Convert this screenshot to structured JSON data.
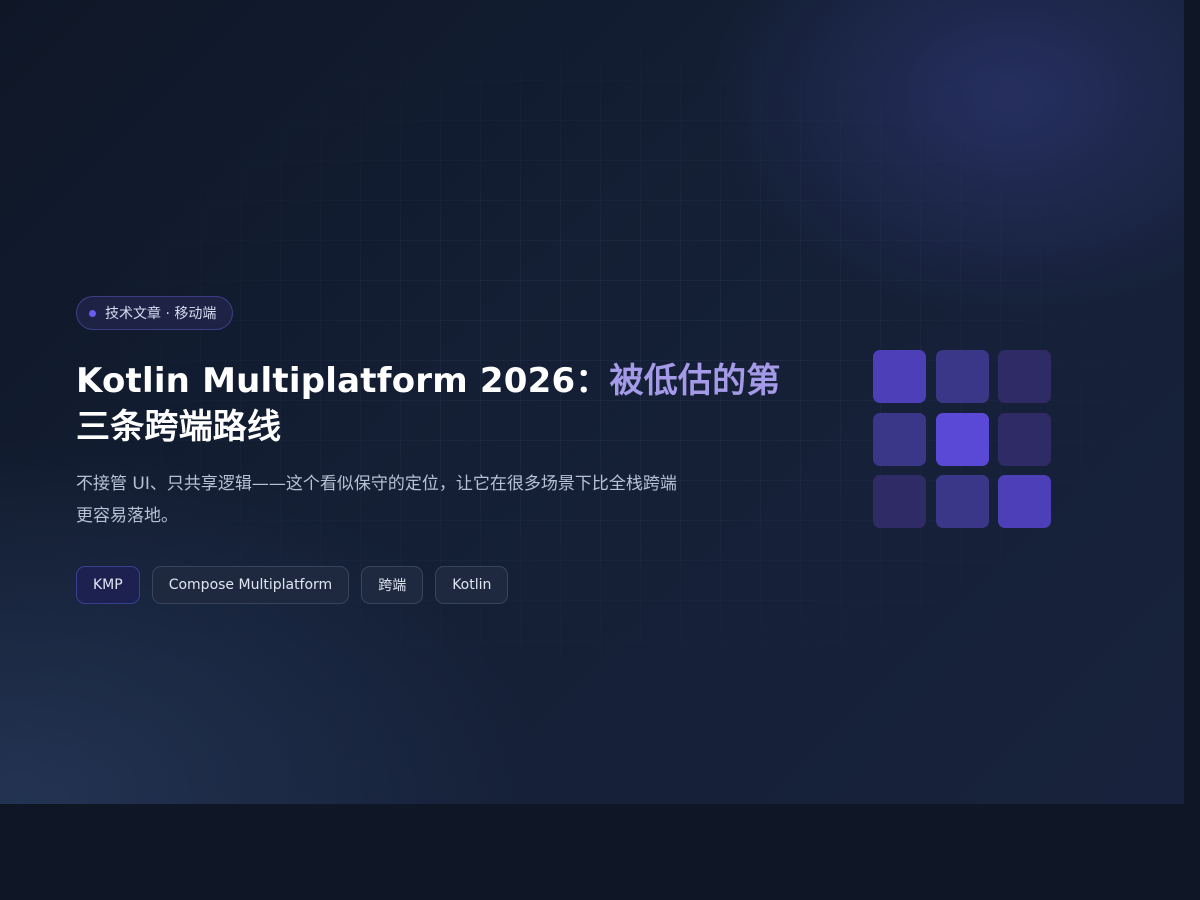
{
  "hero": {
    "category": "技术文章 · 移动端",
    "title_en": "Kotlin Multiplatform 2026：",
    "title_zh_accent": "被低估的第",
    "title_zh_rest": "三条跨端路线",
    "subtitle": "不接管 UI、只共享逻辑——这个看似保守的定位，让它在很多场景下比全栈跨端更容易落地。",
    "tags": [
      "KMP",
      "Compose Multiplatform",
      "跨端",
      "Kotlin"
    ]
  },
  "decoration": {
    "tile_colors": [
      "#4c3fb8",
      "#3a3688",
      "#2e2b66",
      "#3a3688",
      "#5a49d6",
      "#2e2b66",
      "#2e2b66",
      "#3a3688",
      "#4c3fb8"
    ]
  },
  "colors": {
    "accent": "#6a5cf0",
    "title_accent": "#a49ae8",
    "background": "#0f1626"
  }
}
